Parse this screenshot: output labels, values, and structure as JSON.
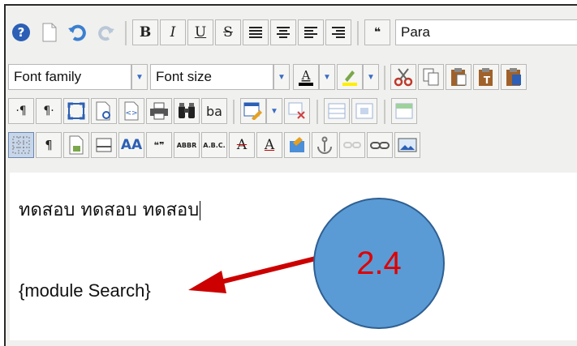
{
  "toolbar1": {
    "bold": "B",
    "italic": "I",
    "underline": "U",
    "strike": "S",
    "blockquote": "❝",
    "format_value": "Para"
  },
  "toolbar2": {
    "font_family": "Font family",
    "font_size": "Font size",
    "text_color_glyph": "A"
  },
  "toolbar3": {
    "show_blocks": "·¶",
    "visual_chars": "¶·",
    "replace": "ba"
  },
  "toolbar4": {
    "paragraph": "¶",
    "styles": "AA",
    "cite": "❝❞",
    "abbr": "ABBR",
    "acronym": "A.B.C.",
    "del": "A",
    "ins": "A"
  },
  "editor": {
    "line1": "ทดสอบ ทดสอบ ทดสอบ",
    "line2": "{module Search}"
  },
  "annotation": {
    "label": "2.4",
    "circle_color": "#5a9bd5",
    "arrow_color": "#cc0000"
  }
}
